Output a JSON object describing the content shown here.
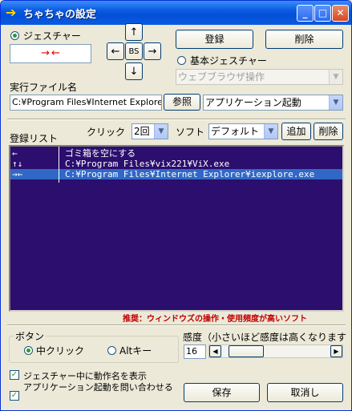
{
  "window": {
    "title": "ちゃちゃの設定"
  },
  "gesture": {
    "radio_label": "ジェスチャー",
    "preview": "→←",
    "pad": {
      "up": "↑",
      "left": "←",
      "center": "BS",
      "right": "→",
      "down": "↓"
    }
  },
  "buttons": {
    "register": "登録",
    "delete": "削除",
    "browse": "参照",
    "add": "追加",
    "delete_small": "削除",
    "save": "保存",
    "cancel": "取消し"
  },
  "basic": {
    "radio_label": "基本ジェスチャー",
    "select_value": "ウェブブラウザ操作"
  },
  "exec": {
    "label": "実行ファイル名",
    "path": "C:¥Program Files¥Internet Explorer¥i",
    "mode": "アプリケーション起動"
  },
  "list": {
    "label": "登録リスト",
    "click_label": "クリック",
    "click_value": "2回",
    "soft_label": "ソフト",
    "soft_value": "デフォルト",
    "rows": [
      {
        "gesture": "←",
        "action": "ゴミ箱を空にする"
      },
      {
        "gesture": "↑↓",
        "action": "C:¥Program Files¥vix221¥ViX.exe"
      },
      {
        "gesture": "→←",
        "action": "C:¥Program Files¥Internet Explorer¥iexplore.exe"
      }
    ],
    "note": "推奨：ウィンドウズの操作・使用頻度が高いソフト",
    "note_color": "#c00000"
  },
  "button_group": {
    "label": "ボタン",
    "middle": "中クリック",
    "alt": "Altキー"
  },
  "sensitivity": {
    "label": "感度（小さいほど感度は高くなります",
    "value": "16",
    "level_fraction": 0.1
  },
  "options": {
    "show_action": "ジェスチャー中に動作名を表示",
    "confirm_app": "アプリケーション起動を問い合わせる"
  },
  "colors": {
    "list_bg": "#2b0e6e",
    "selection": "#3168c6",
    "title_blue": "#0a5ae3"
  }
}
